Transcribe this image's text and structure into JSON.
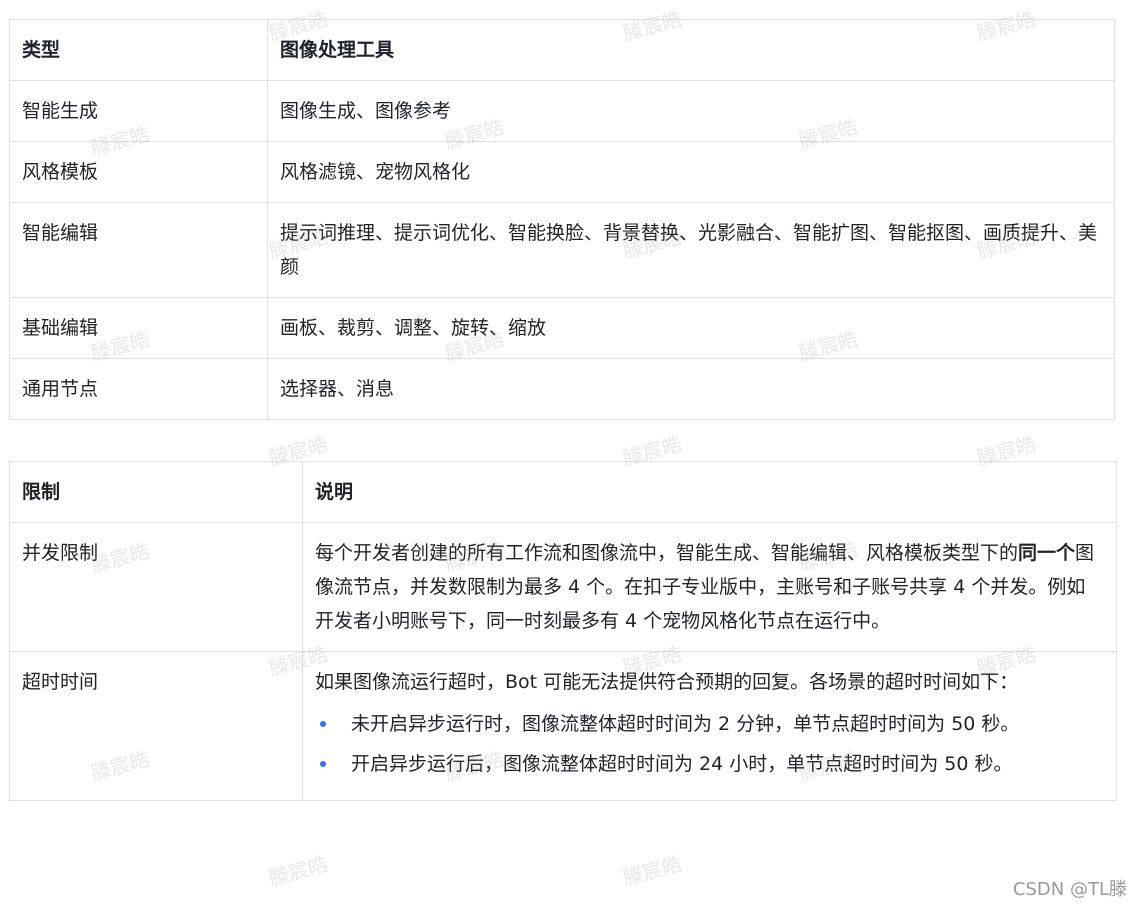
{
  "table1": {
    "headers": [
      "类型",
      "图像处理工具"
    ],
    "rows": [
      [
        "智能生成",
        "图像生成、图像参考"
      ],
      [
        "风格模板",
        "风格滤镜、宠物风格化"
      ],
      [
        "智能编辑",
        "提示词推理、提示词优化、智能换脸、背景替换、光影融合、智能扩图、智能抠图、画质提升、美颜"
      ],
      [
        "基础编辑",
        "画板、裁剪、调整、旋转、缩放"
      ],
      [
        "通用节点",
        "选择器、消息"
      ]
    ]
  },
  "table2": {
    "headers": [
      "限制",
      "说明"
    ],
    "concurrency": {
      "label": "并发限制",
      "text_before": "每个开发者创建的所有工作流和图像流中，智能生成、智能编辑、风格模板类型下的",
      "text_bold": "同一个",
      "text_after": "图像流节点，并发数限制为最多 4 个。在扣子专业版中，主账号和子账号共享 4 个并发。例如开发者小明账号下，同一时刻最多有 4 个宠物风格化节点在运行中。"
    },
    "timeout": {
      "label": "超时时间",
      "intro": "如果图像流运行超时，Bot 可能无法提供符合预期的回复。各场景的超时时间如下：",
      "bullets": [
        "未开启异步运行时，图像流整体超时时间为 2 分钟，单节点超时时间为 50 秒。",
        "开启异步运行后，图像流整体超时时间为 24 小时，单节点超时时间为 50 秒。"
      ]
    }
  },
  "watermark": "滕宸皓",
  "footer": "CSDN @TL滕",
  "colors": {
    "border": "#dee0e3",
    "text": "#1f2329",
    "bullet": "#3370ff"
  }
}
